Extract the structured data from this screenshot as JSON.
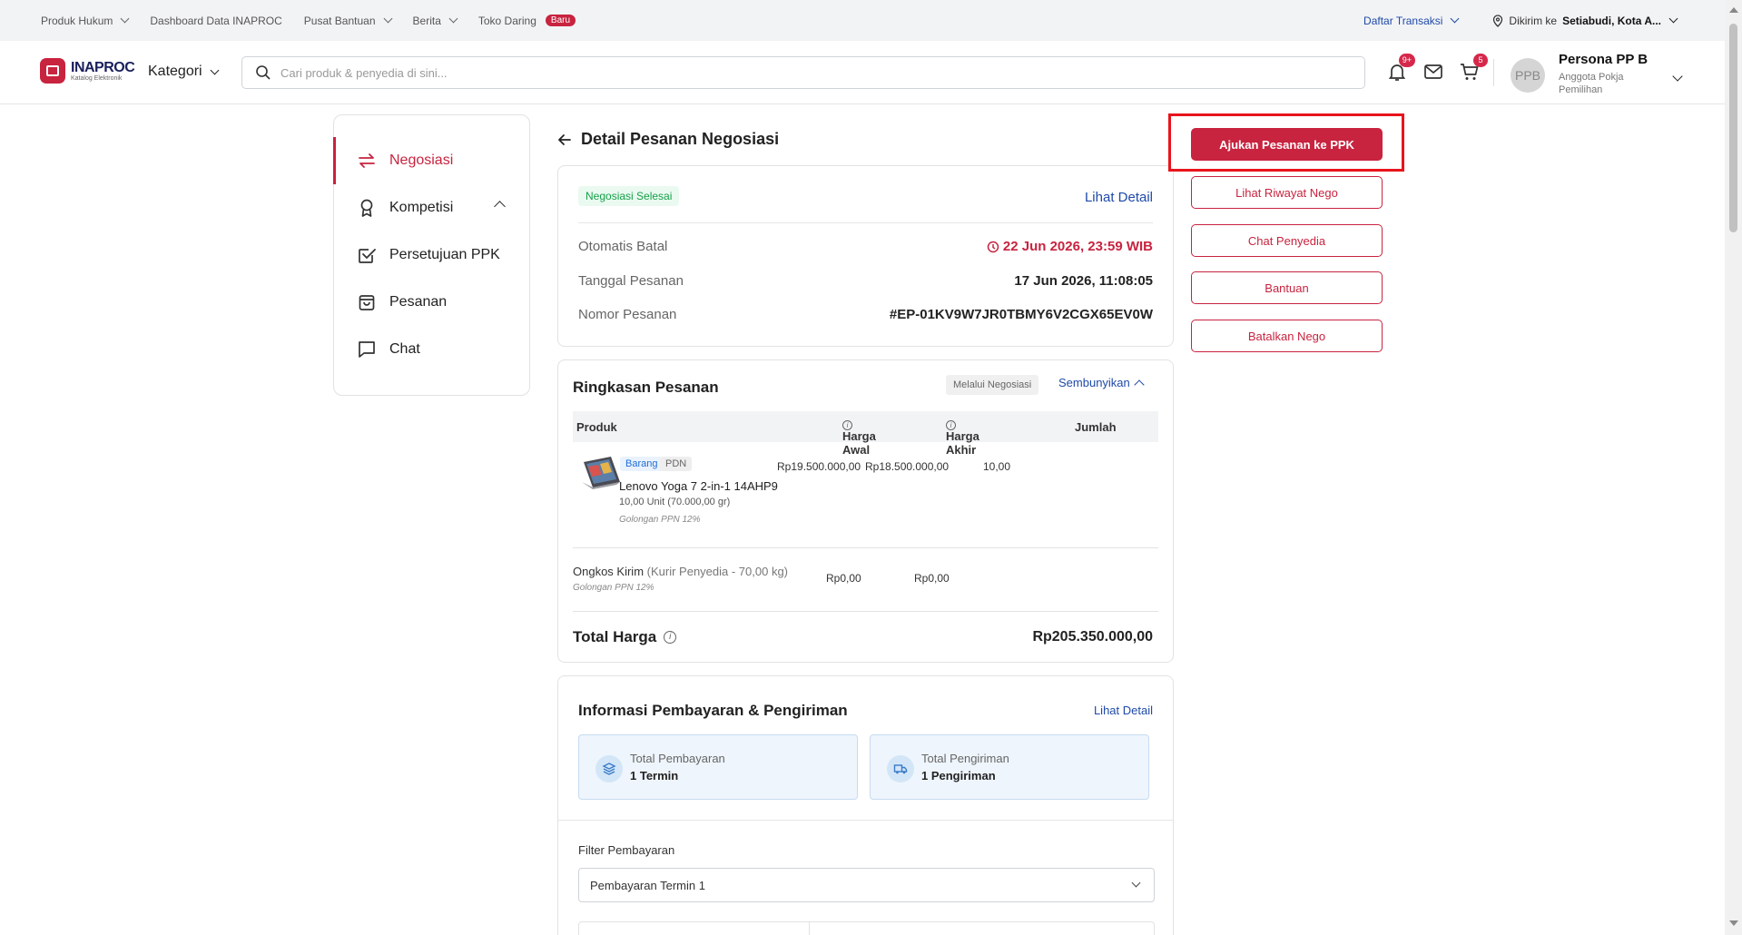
{
  "topbar": {
    "items": [
      {
        "label": "Produk Hukum",
        "has_dropdown": true
      },
      {
        "label": "Dashboard Data INAPROC",
        "has_dropdown": false
      },
      {
        "label": "Pusat Bantuan",
        "has_dropdown": true
      },
      {
        "label": "Berita",
        "has_dropdown": true
      },
      {
        "label": "Toko Daring",
        "badge": "Baru"
      }
    ],
    "transactions_label": "Daftar Transaksi",
    "ship_prefix": "Dikirim ke",
    "ship_location": "Setiabudi, Kota A..."
  },
  "header": {
    "logo_title": "INAPROC",
    "logo_subtitle": "Katalog Elektronik",
    "kategori_label": "Kategori",
    "search_placeholder": "Cari produk & penyedia di sini...",
    "notif_count": "9+",
    "cart_count": "5",
    "avatar_initials": "PPB",
    "user_name": "Persona PP B",
    "user_role": "Anggota Pokja Pemilihan"
  },
  "sidebar": {
    "items": [
      {
        "label": "Negosiasi",
        "icon": "swap-arrows-icon",
        "active": true
      },
      {
        "label": "Kompetisi",
        "icon": "award-icon",
        "expanded": true
      },
      {
        "label": "Persetujuan PPK",
        "icon": "checkbox-icon"
      },
      {
        "label": "Pesanan",
        "icon": "shopping-bag-icon"
      },
      {
        "label": "Chat",
        "icon": "chat-bubble-icon"
      }
    ]
  },
  "page": {
    "title": "Detail Pesanan Negosiasi"
  },
  "order": {
    "status": "Negosiasi Selesai",
    "lihat_detail": "Lihat Detail",
    "otomatis_batal_label": "Otomatis Batal",
    "otomatis_batal_value": "22 Jun 2026, 23:59 WIB",
    "tanggal_label": "Tanggal Pesanan",
    "tanggal_value": "17 Jun 2026, 11:08:05",
    "nomor_label": "Nomor Pesanan",
    "nomor_value": "#EP-01KV9W7JR0TBMY6V2CGX65EV0W"
  },
  "summary": {
    "title": "Ringkasan Pesanan",
    "via": "Melalui Negosiasi",
    "toggle": "Sembunyikan",
    "columns": [
      "Produk",
      "Harga Awal",
      "Harga Akhir",
      "Jumlah"
    ],
    "product": {
      "tag1": "Barang",
      "tag2": "PDN",
      "name": "Lenovo Yoga 7 2-in-1 14AHP9",
      "qty": "10,00 Unit (70.000,00 gr)",
      "ppn": "Golongan PPN 12%",
      "harga_awal": "Rp19.500.000,00",
      "harga_akhir": "Rp18.500.000,00",
      "jumlah": "10,00"
    },
    "ongkos": {
      "label": "Ongkos Kirim",
      "detail": "(Kurir Penyedia - 70,00 kg)",
      "ppn": "Golongan PPN 12%",
      "harga_awal": "Rp0,00",
      "harga_akhir": "Rp0,00"
    },
    "total_label": "Total Harga",
    "total_value": "Rp205.350.000,00"
  },
  "payment": {
    "title": "Informasi Pembayaran & Pengiriman",
    "lihat_detail": "Lihat Detail",
    "total_pembayaran_label": "Total Pembayaran",
    "total_pembayaran_value": "1 Termin",
    "total_pengiriman_label": "Total Pengiriman",
    "total_pengiriman_value": "1 Pengiriman",
    "filter_label": "Filter Pembayaran",
    "filter_value": "Pembayaran Termin 1"
  },
  "actions": {
    "ajukan": "Ajukan Pesanan ke PPK",
    "riwayat": "Lihat Riwayat Nego",
    "chat": "Chat Penyedia",
    "bantuan": "Bantuan",
    "batalkan": "Batalkan Nego"
  },
  "colors": {
    "brand": "#c8233f",
    "link": "#1f4aa8",
    "success": "#17a04a",
    "highlight": "#e8141c"
  }
}
